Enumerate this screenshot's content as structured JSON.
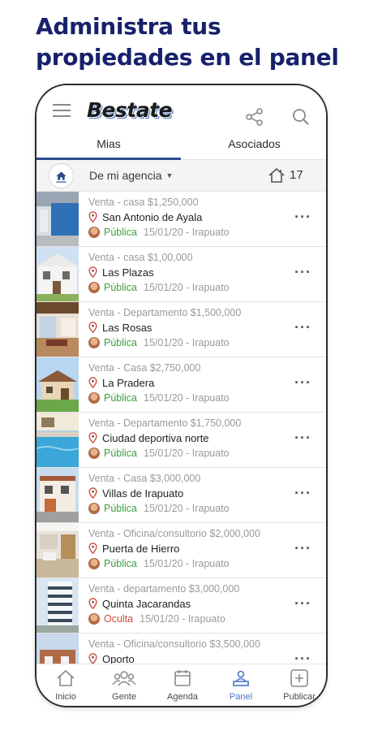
{
  "headline": {
    "line1": "Administra tus",
    "line2": "propiedades en el panel"
  },
  "app": {
    "logo": "Bestate"
  },
  "tabs": [
    {
      "label": "Mias",
      "active": true
    },
    {
      "label": "Asociados",
      "active": false
    }
  ],
  "filter": {
    "label": "De mi agencia",
    "count": "17"
  },
  "listings": [
    {
      "title": "Venta - casa  $1,250,000",
      "location": "San Antonio de Ayala",
      "status": "Pública",
      "date_city": "15/01/20 - Irapuato",
      "image": "blue-wall"
    },
    {
      "title": "Venta - casa  $1,00,000",
      "location": "Las Plazas",
      "status": "Pública",
      "date_city": "15/01/20 - Irapuato",
      "image": "white-house"
    },
    {
      "title": "Venta - Departamento  $1,500,000",
      "location": "Las Rosas",
      "status": "Pública",
      "date_city": "15/01/20 - Irapuato",
      "image": "interior"
    },
    {
      "title": "Venta - Casa    $2,750,000",
      "location": "La Pradera",
      "status": "Pública",
      "date_city": "15/01/20 - Irapuato",
      "image": "house-lawn"
    },
    {
      "title": "Venta - Departamento  $1,750,000",
      "location": "Ciudad deportiva norte",
      "status": "Pública",
      "date_city": "15/01/20 - Irapuato",
      "image": "pool"
    },
    {
      "title": "Venta - Casa  $3,000,000",
      "location": "Villas de Irapuato",
      "status": "Pública",
      "date_city": "15/01/20 - Irapuato",
      "image": "townhouse"
    },
    {
      "title": "Venta - Oficina/consultorio  $2,000,000",
      "location": "Puerta de Hierro",
      "status": "Pública",
      "date_city": "15/01/20 - Irapuato",
      "image": "office"
    },
    {
      "title": "Venta - departamento  $3,000,000",
      "location": "Quinta Jacarandas",
      "status": "Oculta",
      "date_city": "15/01/20 - Irapuato",
      "image": "tower"
    },
    {
      "title": "Venta - Oficina/consultorio  $3,500,000",
      "location": "Oporto",
      "status": "",
      "date_city": "",
      "image": "brick"
    }
  ],
  "bottom_nav": [
    {
      "label": "Inicio",
      "icon": "home-icon",
      "active": false
    },
    {
      "label": "Gente",
      "icon": "people-icon",
      "active": false
    },
    {
      "label": "Agenda",
      "icon": "calendar-icon",
      "active": false
    },
    {
      "label": "Panel",
      "icon": "panel-icon",
      "active": true
    },
    {
      "label": "Publicar",
      "icon": "plus-square-icon",
      "active": false
    }
  ],
  "colors": {
    "headline": "#17216b",
    "tab_indicator": "#2b4a8a",
    "status_public": "#3f9e3f",
    "status_hidden": "#d24b3c",
    "nav_active": "#4a74c4"
  }
}
